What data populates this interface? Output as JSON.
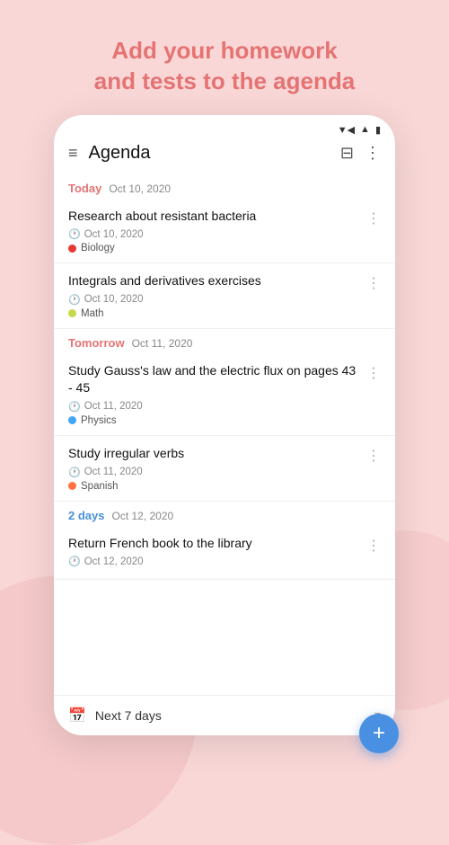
{
  "header": {
    "line1": "Add your homework",
    "line2_prefix": "and tests to the ",
    "line2_highlight": "agenda"
  },
  "status_bar": {
    "wifi": "▲",
    "signal": "▲",
    "battery": "▪"
  },
  "app": {
    "title": "Agenda",
    "menu_icon": "≡",
    "filter_icon": "☰",
    "more_icon": "⋮"
  },
  "sections": [
    {
      "label": "Today",
      "label_class": "today",
      "date": "Oct 10, 2020",
      "tasks": [
        {
          "title": "Research about resistant bacteria",
          "date": "Oct 10, 2020",
          "subject": "Biology",
          "subject_class": "biology"
        },
        {
          "title": "Integrals and derivatives exercises",
          "date": "Oct 10, 2020",
          "subject": "Math",
          "subject_class": "math"
        }
      ]
    },
    {
      "label": "Tomorrow",
      "label_class": "tomorrow",
      "date": "Oct 11, 2020",
      "tasks": [
        {
          "title": "Study Gauss's law and the electric flux on pages 43 - 45",
          "date": "Oct 11, 2020",
          "subject": "Physics",
          "subject_class": "physics"
        },
        {
          "title": "Study irregular verbs",
          "date": "Oct 11, 2020",
          "subject": "Spanish",
          "subject_class": "spanish"
        }
      ]
    },
    {
      "label": "2 days",
      "label_class": "twodays",
      "date": "Oct 12, 2020",
      "tasks": [
        {
          "title": "Return French book to the library",
          "date": "Oct 12, 2020",
          "subject": "",
          "subject_class": ""
        }
      ]
    }
  ],
  "bottom_bar": {
    "text": "Next 7 days"
  },
  "fab_icon": "+"
}
